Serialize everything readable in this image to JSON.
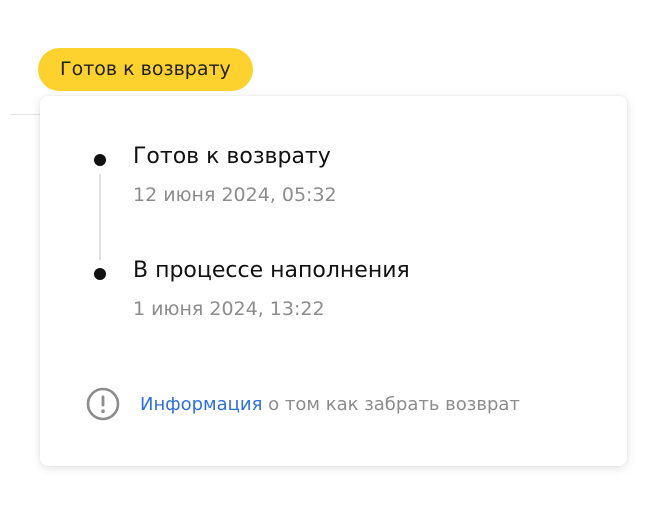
{
  "status_badge": {
    "label": "Готов к возврату",
    "color": "#fdd22f"
  },
  "timeline": {
    "events": [
      {
        "title": "Готов к возврату",
        "date": "12 июня 2024, 05:32"
      },
      {
        "title": "В процессе наполнения",
        "date": "1 июня 2024, 13:22"
      }
    ]
  },
  "info": {
    "icon": "exclamation-circle-icon",
    "link_label": "Информация",
    "text": " о том как забрать возврат",
    "link_color": "#2e6fe0"
  }
}
